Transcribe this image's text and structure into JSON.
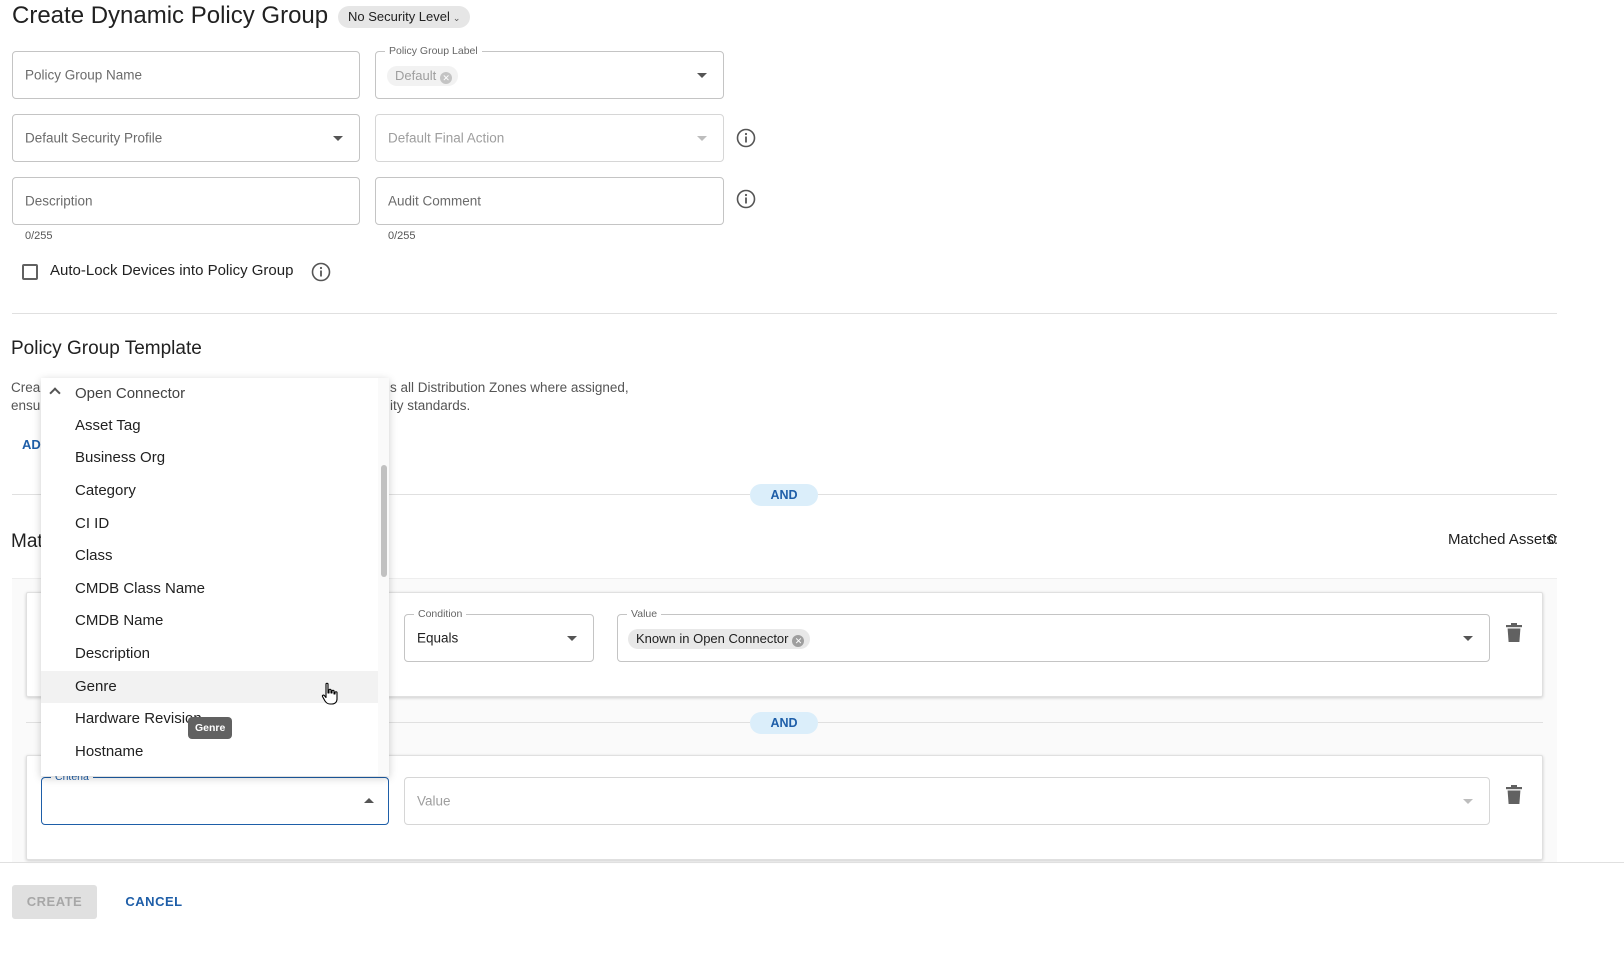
{
  "header": {
    "title": "Create Dynamic Policy Group",
    "security_level": "No Security Level"
  },
  "form": {
    "policy_group_name_placeholder": "Policy Group Name",
    "policy_group_label_label": "Policy Group Label",
    "policy_group_label_chip": "Default",
    "default_security_profile_placeholder": "Default Security Profile",
    "default_final_action_placeholder": "Default Final Action",
    "description_placeholder": "Description",
    "description_counter": "0/255",
    "audit_comment_placeholder": "Audit Comment",
    "audit_comment_counter": "0/255",
    "auto_lock_label": "Auto-Lock Devices into Policy Group"
  },
  "template": {
    "title": "Policy Group Template",
    "desc_line1_start": "Crea",
    "desc_line1_end": "s all Distribution Zones where assigned,",
    "desc_line2_start": "ensu",
    "desc_line2_end": "ity standards.",
    "add_link": "AD"
  },
  "matching": {
    "title_start": "Mat",
    "matched_assets_label": "Matched Assets:",
    "matched_assets_count": "0",
    "and_label": "AND",
    "rule1": {
      "condition_label": "Condition",
      "condition_value": "Equals",
      "value_label": "Value",
      "value_chip": "Known in Open Connector"
    },
    "rule2": {
      "criteria_label": "Criteria",
      "value_placeholder": "Value"
    }
  },
  "menu": {
    "group": "Open Connector",
    "items": [
      "Asset Tag",
      "Business Org",
      "Category",
      "CI ID",
      "Class",
      "CMDB Class Name",
      "CMDB Name",
      "Description",
      "Genre",
      "Hardware Revision",
      "Hostname"
    ],
    "hovered": "Genre",
    "tooltip": "Genre"
  },
  "footer": {
    "create": "CREATE",
    "cancel": "CANCEL"
  },
  "colors": {
    "accent": "#1e5ea8",
    "and_pill_bg": "#dbeefa"
  }
}
